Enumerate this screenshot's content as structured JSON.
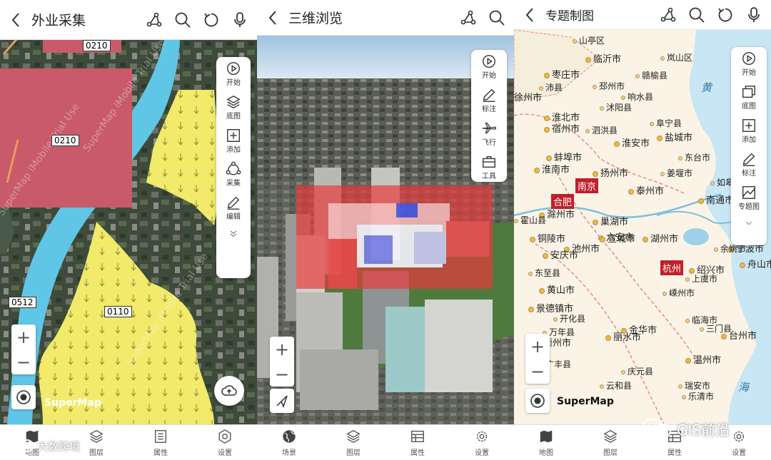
{
  "panel1": {
    "title": "外业采集",
    "toolbar": [
      "开始",
      "底图",
      "添加",
      "采集",
      "编辑"
    ],
    "parcels": [
      "0210",
      "0210",
      "0110",
      "0512"
    ],
    "watermark": "SuperMap iMobile Trial Use",
    "logo": "SuperMap",
    "nav": [
      "地图",
      "图层",
      "属性",
      "设置"
    ]
  },
  "panel2": {
    "title": "三维浏览",
    "toolbar": [
      "开始",
      "标注",
      "飞行",
      "工具"
    ],
    "nav": [
      "场景",
      "图层",
      "属性",
      "设置"
    ]
  },
  "panel3": {
    "title": "专题制图",
    "toolbar": [
      "开始",
      "底图",
      "添加",
      "标注",
      "专题图"
    ],
    "logo": "SuperMap",
    "nav": [
      "地图",
      "图层",
      "属性",
      "设置"
    ],
    "capitals": [
      "南京",
      "合肥",
      "杭州"
    ],
    "cities": [
      "临沂市",
      "枣庄市",
      "徐州市",
      "宿州市",
      "淮北市",
      "淮安市",
      "盐城市",
      "蚌埠市",
      "淮南市",
      "扬州市",
      "泰州市",
      "南通市",
      "滁州市",
      "六安市",
      "巢湖市",
      "芜湖市",
      "马鞍山市",
      "铜陵市",
      "池州市",
      "安庆市",
      "宣城市",
      "湖州市",
      "绍兴市",
      "宁波市",
      "舟山市",
      "黄山市",
      "景德镇市",
      "衢州市",
      "丽水市",
      "台州市",
      "温州市",
      "金华市"
    ],
    "counties": [
      "山亭区",
      "岚山区",
      "沛县",
      "邳州市",
      "赣榆县",
      "沭阳县",
      "响水县",
      "泗洪县",
      "阜宁县",
      "东台市",
      "姜堰市",
      "如皋市",
      "霍山县",
      "东至县",
      "黄山区",
      "开化县",
      "万年县",
      "广丰县",
      "庆元县",
      "云和县",
      "临海市",
      "三门县",
      "上虞市",
      "余姚市",
      "嵊州市",
      "瑞安市",
      "乐清市"
    ],
    "sea_labels": [
      "黄",
      "海"
    ]
  },
  "footer": {
    "left_watermark": "大数跨境",
    "right_watermark": "GIS前沿"
  }
}
